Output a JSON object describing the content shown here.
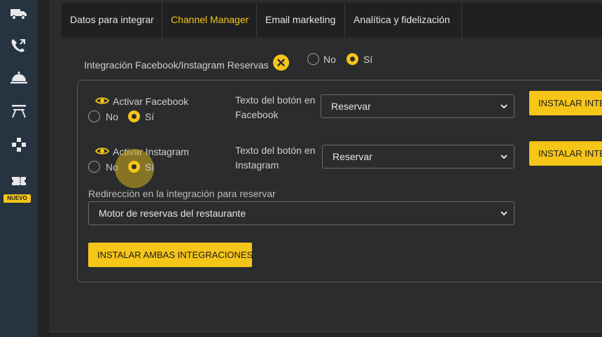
{
  "sidebar": {
    "icons": [
      "truck-icon",
      "phone-icon",
      "cloche-icon",
      "table-icon",
      "gamepad-icon",
      "ticket-icon"
    ],
    "new_badge": "NUEVO"
  },
  "tabs": [
    {
      "label": "Datos para integrar",
      "active": false
    },
    {
      "label": "Channel Manager",
      "active": true
    },
    {
      "label": "Email marketing",
      "active": false
    },
    {
      "label": "Analítica y fidelización",
      "active": false
    }
  ],
  "integration": {
    "label": "Integración Facebook/Instagram Reservas",
    "no_label": "No",
    "yes_label": "Sí",
    "selected": "yes"
  },
  "facebook": {
    "activate_label": "Activar Facebook",
    "no_label": "No",
    "yes_label": "Sí",
    "selected": "yes",
    "button_text_label": "Texto del botón en Facebook",
    "button_text_value": "Reservar",
    "install_label": "INSTALAR INTEGRACIÓN FACEBOOK"
  },
  "instagram": {
    "activate_label": "Activar Instagram",
    "no_label": "No",
    "yes_label": "Sí",
    "selected": "yes",
    "button_text_label": "Texto del botón en Instagram",
    "button_text_value": "Reservar",
    "install_label": "INSTALAR INTEGRACIÓN INSTAGRAM"
  },
  "redirect": {
    "label": "Redirección en la integración para reservar",
    "value": "Motor de reservas del restaurante"
  },
  "install_both_label": "INSTALAR AMBAS INTEGRACIONES",
  "colors": {
    "accent": "#f5c518",
    "sidebar": "#263340",
    "background": "#2b2c2d"
  }
}
